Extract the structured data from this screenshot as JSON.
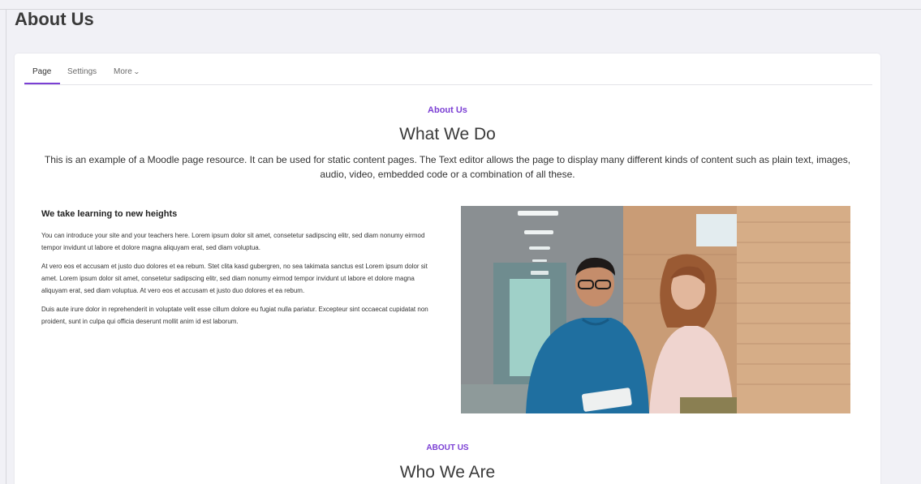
{
  "page": {
    "title": "About Us"
  },
  "tabs": [
    {
      "label": "Page",
      "active": true
    },
    {
      "label": "Settings",
      "active": false
    },
    {
      "label": "More",
      "active": false
    }
  ],
  "section1": {
    "kicker": "About Us",
    "heading": "What We Do",
    "intro": "This is an example of a Moodle page resource. It can be used for static content pages. The Text editor allows the page to display many different kinds of content such as plain text, images, audio, video, embedded code or a combination of all these."
  },
  "content": {
    "subheading": "We take learning to new heights",
    "paragraphs": [
      "You can introduce your site and your teachers here. Lorem ipsum dolor sit amet, consetetur sadipscing elitr, sed diam nonumy eirmod tempor invidunt ut labore et dolore magna aliquyam erat, sed diam voluptua.",
      "At vero eos et accusam et justo duo dolores et ea rebum. Stet clita kasd gubergren, no sea takimata sanctus est Lorem ipsum dolor sit amet. Lorem ipsum dolor sit amet, consetetur sadipscing elitr, sed diam nonumy eirmod tempor invidunt ut labore et dolore magna aliquyam erat, sed diam voluptua. At vero eos et accusam et justo duo dolores et ea rebum.",
      "Duis aute irure dolor in reprehenderit in voluptate velit esse cillum dolore eu fugiat nulla pariatur. Excepteur sint occaecat cupidatat non proident, sunt in culpa qui officia deserunt mollit anim id est laborum."
    ]
  },
  "section2": {
    "kicker": "ABOUT US",
    "heading": "Who We Are"
  },
  "colors": {
    "accent": "#7b3fd4",
    "background": "#f1f1f6",
    "card": "#ffffff"
  },
  "icons": {
    "more_tab": "chevron-down-icon"
  }
}
